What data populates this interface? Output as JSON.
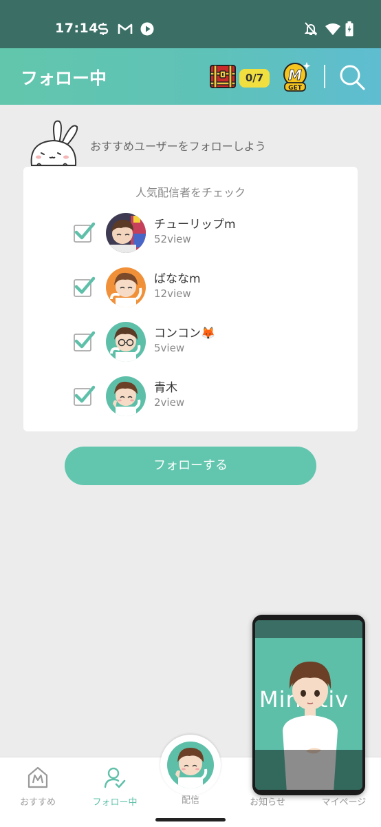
{
  "status_bar": {
    "time": "17:14",
    "left_icons": [
      "app-s-icon",
      "gmail-icon",
      "play-icon"
    ],
    "right_icons": [
      "notifications-off-icon",
      "wifi-icon",
      "battery-icon"
    ]
  },
  "header": {
    "title": "フォロー中",
    "treasure_counter": "0/7",
    "coin_label": "GET",
    "coin_letter": "M"
  },
  "banner": {
    "text": "おすすめユーザーをフォローしよう"
  },
  "card": {
    "title": "人気配信者をチェック",
    "users": [
      {
        "name": "チューリップm",
        "views": "52view",
        "checked": true
      },
      {
        "name": "ばななm",
        "views": "12view",
        "checked": true
      },
      {
        "name": "コンコン🦊",
        "views": "5view",
        "checked": true
      },
      {
        "name": "青木",
        "views": "2view",
        "checked": true
      }
    ]
  },
  "follow_button": "フォローする",
  "bottom_nav": {
    "items": [
      {
        "label": "おすすめ",
        "icon": "home-m-icon"
      },
      {
        "label": "フォロー中",
        "icon": "follow-icon"
      },
      {
        "label": "配信",
        "icon": "live-avatar"
      },
      {
        "label": "お知らせ",
        "icon": "bell-icon"
      },
      {
        "label": "マイページ",
        "icon": "profile-icon"
      }
    ]
  },
  "pip": {
    "logo": "Mirrativ"
  },
  "colors": {
    "accent": "#62c6ae",
    "status_bar": "#3b6f66",
    "counter_bg": "#f1df3f"
  }
}
